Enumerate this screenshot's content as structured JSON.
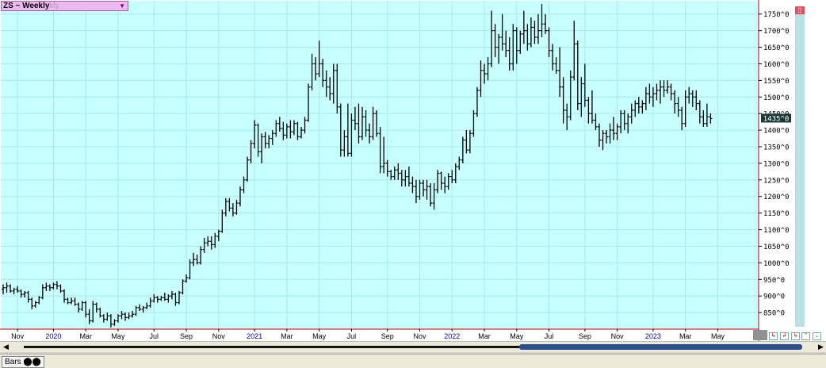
{
  "window": {
    "symbol_label": "ZS ~ Weekly",
    "symbol_label_ghost": "kly",
    "last_price_label": "1435^0",
    "status_tab_label": "Bars"
  },
  "colors": {
    "plot_background": "#c8ffff",
    "grid": "#a8e8ec",
    "bars": "#000000",
    "axis_border": "#c00000",
    "year_label": "#0000c0",
    "price_flag_bg": "#1a3a3a",
    "price_flag_text": "#ffffff"
  },
  "chart_data": {
    "type": "ohlc",
    "title": "ZS ~ Weekly",
    "xlabel": "",
    "ylabel": "",
    "ylim": [
      800,
      1790
    ],
    "grid": true,
    "y_ticks": [
      850,
      900,
      950,
      1000,
      1050,
      1100,
      1150,
      1200,
      1250,
      1300,
      1350,
      1400,
      1450,
      1500,
      1550,
      1600,
      1650,
      1700,
      1750
    ],
    "y_tick_labels": [
      "850^0",
      "900^0",
      "950^0",
      "1000^0",
      "1050^0",
      "1100^0",
      "1150^0",
      "1200^0",
      "1250^0",
      "1300^0",
      "1350^0",
      "1400^0",
      "1450^0",
      "1500^0",
      "1550^0",
      "1600^0",
      "1650^0",
      "1700^0",
      "1750^0"
    ],
    "x_ticks": [
      {
        "label": "Nov",
        "week": 4,
        "year": false
      },
      {
        "label": "2020",
        "week": 14,
        "year": true
      },
      {
        "label": "Mar",
        "week": 23,
        "year": false
      },
      {
        "label": "May",
        "week": 32,
        "year": false
      },
      {
        "label": "Jul",
        "week": 42,
        "year": false
      },
      {
        "label": "Sep",
        "week": 51,
        "year": false
      },
      {
        "label": "Nov",
        "week": 60,
        "year": false
      },
      {
        "label": "2021",
        "week": 70,
        "year": true
      },
      {
        "label": "Mar",
        "week": 79,
        "year": false
      },
      {
        "label": "May",
        "week": 88,
        "year": false
      },
      {
        "label": "Jul",
        "week": 97,
        "year": false
      },
      {
        "label": "Sep",
        "week": 107,
        "year": false
      },
      {
        "label": "Nov",
        "week": 116,
        "year": false
      },
      {
        "label": "2022",
        "week": 125,
        "year": true
      },
      {
        "label": "Mar",
        "week": 134,
        "year": false
      },
      {
        "label": "May",
        "week": 143,
        "year": false
      },
      {
        "label": "Jul",
        "week": 152,
        "year": false
      },
      {
        "label": "Sep",
        "week": 162,
        "year": false
      },
      {
        "label": "Nov",
        "week": 171,
        "year": false
      },
      {
        "label": "2023",
        "week": 181,
        "year": true
      },
      {
        "label": "Mar",
        "week": 190,
        "year": false
      },
      {
        "label": "May",
        "week": 199,
        "year": false
      }
    ],
    "last_price": 1435,
    "bars": [
      [
        920,
        935,
        905,
        925
      ],
      [
        925,
        940,
        910,
        930
      ],
      [
        930,
        935,
        910,
        915
      ],
      [
        915,
        925,
        905,
        920
      ],
      [
        920,
        930,
        910,
        915
      ],
      [
        915,
        920,
        895,
        905
      ],
      [
        905,
        915,
        895,
        910
      ],
      [
        910,
        915,
        880,
        890
      ],
      [
        890,
        895,
        860,
        870
      ],
      [
        870,
        885,
        865,
        880
      ],
      [
        880,
        900,
        875,
        895
      ],
      [
        895,
        935,
        890,
        925
      ],
      [
        925,
        940,
        915,
        930
      ],
      [
        930,
        935,
        915,
        925
      ],
      [
        925,
        940,
        920,
        935
      ],
      [
        935,
        945,
        920,
        930
      ],
      [
        930,
        935,
        910,
        915
      ],
      [
        915,
        920,
        880,
        890
      ],
      [
        890,
        895,
        875,
        880
      ],
      [
        880,
        895,
        875,
        885
      ],
      [
        885,
        895,
        870,
        875
      ],
      [
        875,
        880,
        850,
        860
      ],
      [
        860,
        885,
        855,
        880
      ],
      [
        880,
        885,
        835,
        845
      ],
      [
        845,
        860,
        815,
        825
      ],
      [
        825,
        885,
        820,
        875
      ],
      [
        875,
        880,
        850,
        860
      ],
      [
        860,
        865,
        835,
        840
      ],
      [
        840,
        845,
        820,
        830
      ],
      [
        830,
        850,
        825,
        840
      ],
      [
        840,
        845,
        805,
        815
      ],
      [
        815,
        830,
        810,
        825
      ],
      [
        825,
        845,
        820,
        840
      ],
      [
        840,
        855,
        830,
        845
      ],
      [
        845,
        850,
        825,
        835
      ],
      [
        835,
        850,
        830,
        840
      ],
      [
        840,
        855,
        835,
        845
      ],
      [
        845,
        870,
        840,
        865
      ],
      [
        865,
        875,
        855,
        860
      ],
      [
        860,
        870,
        850,
        865
      ],
      [
        865,
        880,
        860,
        870
      ],
      [
        870,
        895,
        865,
        885
      ],
      [
        885,
        905,
        880,
        895
      ],
      [
        895,
        900,
        880,
        890
      ],
      [
        890,
        900,
        885,
        895
      ],
      [
        895,
        910,
        885,
        890
      ],
      [
        890,
        905,
        880,
        900
      ],
      [
        900,
        915,
        890,
        905
      ],
      [
        905,
        910,
        870,
        880
      ],
      [
        880,
        915,
        875,
        910
      ],
      [
        910,
        950,
        905,
        945
      ],
      [
        945,
        965,
        940,
        955
      ],
      [
        955,
        1010,
        950,
        1000
      ],
      [
        1000,
        1030,
        990,
        1010
      ],
      [
        1010,
        1025,
        995,
        1000
      ],
      [
        1000,
        1050,
        995,
        1040
      ],
      [
        1040,
        1075,
        1030,
        1060
      ],
      [
        1060,
        1080,
        1050,
        1065
      ],
      [
        1065,
        1080,
        1040,
        1055
      ],
      [
        1055,
        1090,
        1045,
        1080
      ],
      [
        1080,
        1100,
        1065,
        1095
      ],
      [
        1095,
        1160,
        1090,
        1150
      ],
      [
        1150,
        1195,
        1140,
        1185
      ],
      [
        1185,
        1195,
        1155,
        1165
      ],
      [
        1165,
        1180,
        1140,
        1150
      ],
      [
        1150,
        1190,
        1145,
        1180
      ],
      [
        1180,
        1230,
        1170,
        1220
      ],
      [
        1220,
        1260,
        1210,
        1250
      ],
      [
        1250,
        1320,
        1245,
        1310
      ],
      [
        1310,
        1370,
        1300,
        1360
      ],
      [
        1360,
        1430,
        1345,
        1415
      ],
      [
        1415,
        1420,
        1320,
        1335
      ],
      [
        1335,
        1390,
        1300,
        1380
      ],
      [
        1380,
        1395,
        1345,
        1360
      ],
      [
        1360,
        1385,
        1345,
        1375
      ],
      [
        1375,
        1400,
        1355,
        1390
      ],
      [
        1390,
        1430,
        1380,
        1420
      ],
      [
        1420,
        1440,
        1395,
        1405
      ],
      [
        1405,
        1425,
        1370,
        1385
      ],
      [
        1385,
        1420,
        1375,
        1410
      ],
      [
        1410,
        1430,
        1375,
        1395
      ],
      [
        1395,
        1430,
        1385,
        1420
      ],
      [
        1420,
        1425,
        1370,
        1380
      ],
      [
        1380,
        1410,
        1375,
        1400
      ],
      [
        1400,
        1440,
        1390,
        1430
      ],
      [
        1430,
        1540,
        1425,
        1530
      ],
      [
        1530,
        1630,
        1520,
        1600
      ],
      [
        1600,
        1620,
        1550,
        1570
      ],
      [
        1570,
        1670,
        1560,
        1600
      ],
      [
        1600,
        1615,
        1530,
        1550
      ],
      [
        1550,
        1580,
        1500,
        1530
      ],
      [
        1530,
        1560,
        1490,
        1510
      ],
      [
        1510,
        1600,
        1480,
        1580
      ],
      [
        1580,
        1600,
        1450,
        1470
      ],
      [
        1470,
        1480,
        1320,
        1340
      ],
      [
        1340,
        1400,
        1320,
        1380
      ],
      [
        1380,
        1480,
        1320,
        1330
      ],
      [
        1330,
        1450,
        1320,
        1430
      ],
      [
        1430,
        1470,
        1400,
        1420
      ],
      [
        1420,
        1480,
        1360,
        1380
      ],
      [
        1380,
        1470,
        1370,
        1440
      ],
      [
        1440,
        1460,
        1380,
        1400
      ],
      [
        1400,
        1420,
        1360,
        1380
      ],
      [
        1380,
        1470,
        1370,
        1450
      ],
      [
        1450,
        1460,
        1380,
        1390
      ],
      [
        1390,
        1410,
        1270,
        1290
      ],
      [
        1290,
        1380,
        1270,
        1300
      ],
      [
        1300,
        1310,
        1260,
        1275
      ],
      [
        1275,
        1280,
        1250,
        1260
      ],
      [
        1260,
        1290,
        1250,
        1280
      ],
      [
        1280,
        1300,
        1250,
        1270
      ],
      [
        1270,
        1280,
        1230,
        1250
      ],
      [
        1250,
        1280,
        1230,
        1260
      ],
      [
        1260,
        1290,
        1230,
        1240
      ],
      [
        1240,
        1260,
        1210,
        1230
      ],
      [
        1230,
        1250,
        1180,
        1200
      ],
      [
        1200,
        1250,
        1190,
        1240
      ],
      [
        1240,
        1250,
        1200,
        1220
      ],
      [
        1220,
        1250,
        1190,
        1230
      ],
      [
        1230,
        1240,
        1170,
        1180
      ],
      [
        1180,
        1240,
        1160,
        1220
      ],
      [
        1220,
        1280,
        1210,
        1270
      ],
      [
        1270,
        1275,
        1220,
        1240
      ],
      [
        1240,
        1260,
        1210,
        1230
      ],
      [
        1230,
        1270,
        1220,
        1260
      ],
      [
        1260,
        1280,
        1240,
        1250
      ],
      [
        1250,
        1300,
        1240,
        1290
      ],
      [
        1290,
        1320,
        1280,
        1310
      ],
      [
        1310,
        1380,
        1300,
        1370
      ],
      [
        1370,
        1400,
        1330,
        1340
      ],
      [
        1340,
        1400,
        1330,
        1390
      ],
      [
        1390,
        1460,
        1380,
        1450
      ],
      [
        1450,
        1530,
        1440,
        1520
      ],
      [
        1520,
        1610,
        1500,
        1580
      ],
      [
        1580,
        1600,
        1540,
        1570
      ],
      [
        1570,
        1620,
        1550,
        1600
      ],
      [
        1600,
        1760,
        1590,
        1700
      ],
      [
        1700,
        1720,
        1620,
        1650
      ],
      [
        1650,
        1690,
        1600,
        1680
      ],
      [
        1680,
        1750,
        1640,
        1660
      ],
      [
        1660,
        1700,
        1620,
        1640
      ],
      [
        1640,
        1680,
        1580,
        1600
      ],
      [
        1600,
        1720,
        1580,
        1700
      ],
      [
        1700,
        1710,
        1600,
        1640
      ],
      [
        1640,
        1700,
        1630,
        1690
      ],
      [
        1690,
        1760,
        1660,
        1700
      ],
      [
        1700,
        1720,
        1640,
        1660
      ],
      [
        1660,
        1740,
        1650,
        1710
      ],
      [
        1710,
        1730,
        1660,
        1680
      ],
      [
        1680,
        1750,
        1660,
        1700
      ],
      [
        1700,
        1780,
        1680,
        1720
      ],
      [
        1720,
        1750,
        1690,
        1700
      ],
      [
        1700,
        1710,
        1620,
        1640
      ],
      [
        1640,
        1660,
        1580,
        1600
      ],
      [
        1600,
        1620,
        1570,
        1580
      ],
      [
        1580,
        1650,
        1500,
        1530
      ],
      [
        1530,
        1560,
        1420,
        1460
      ],
      [
        1460,
        1480,
        1400,
        1440
      ],
      [
        1440,
        1580,
        1430,
        1560
      ],
      [
        1560,
        1730,
        1550,
        1660
      ],
      [
        1660,
        1670,
        1460,
        1480
      ],
      [
        1480,
        1560,
        1440,
        1540
      ],
      [
        1540,
        1600,
        1470,
        1490
      ],
      [
        1490,
        1500,
        1420,
        1450
      ],
      [
        1450,
        1520,
        1420,
        1430
      ],
      [
        1430,
        1450,
        1400,
        1410
      ],
      [
        1410,
        1420,
        1350,
        1370
      ],
      [
        1370,
        1400,
        1340,
        1390
      ],
      [
        1390,
        1400,
        1360,
        1380
      ],
      [
        1380,
        1420,
        1360,
        1400
      ],
      [
        1400,
        1440,
        1370,
        1390
      ],
      [
        1390,
        1420,
        1370,
        1410
      ],
      [
        1410,
        1460,
        1390,
        1450
      ],
      [
        1450,
        1460,
        1400,
        1420
      ],
      [
        1420,
        1450,
        1390,
        1440
      ],
      [
        1440,
        1480,
        1420,
        1460
      ],
      [
        1460,
        1490,
        1440,
        1480
      ],
      [
        1480,
        1500,
        1450,
        1470
      ],
      [
        1470,
        1490,
        1450,
        1480
      ],
      [
        1480,
        1530,
        1460,
        1510
      ],
      [
        1510,
        1540,
        1480,
        1500
      ],
      [
        1500,
        1530,
        1470,
        1510
      ],
      [
        1510,
        1540,
        1490,
        1520
      ],
      [
        1520,
        1550,
        1480,
        1530
      ],
      [
        1530,
        1550,
        1500,
        1520
      ],
      [
        1520,
        1550,
        1510,
        1530
      ],
      [
        1530,
        1540,
        1490,
        1510
      ],
      [
        1510,
        1520,
        1450,
        1480
      ],
      [
        1480,
        1500,
        1440,
        1460
      ],
      [
        1460,
        1470,
        1400,
        1420
      ],
      [
        1420,
        1520,
        1410,
        1500
      ],
      [
        1500,
        1530,
        1480,
        1510
      ],
      [
        1510,
        1520,
        1470,
        1500
      ],
      [
        1500,
        1520,
        1460,
        1480
      ],
      [
        1480,
        1490,
        1420,
        1440
      ],
      [
        1440,
        1460,
        1410,
        1420
      ],
      [
        1420,
        1480,
        1410,
        1440
      ],
      [
        1440,
        1450,
        1420,
        1435
      ]
    ]
  }
}
